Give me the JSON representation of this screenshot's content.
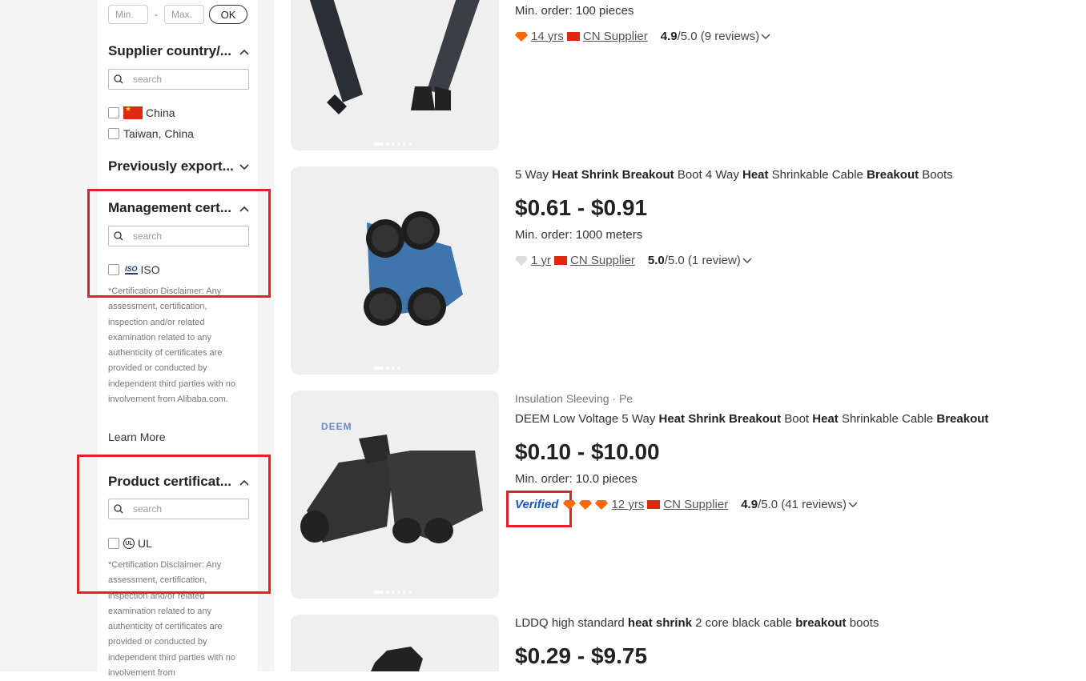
{
  "filters": {
    "price": {
      "min_placeholder": "Min.",
      "max_placeholder": "Max.",
      "dash": "-",
      "ok_label": "OK"
    },
    "supplier_country": {
      "title": "Supplier country/...",
      "search_placeholder": "search",
      "options": [
        "China",
        "Taiwan, China"
      ]
    },
    "previously_export": {
      "title": "Previously export..."
    },
    "management_cert": {
      "title": "Management cert...",
      "search_placeholder": "search",
      "option": "ISO",
      "option_logo": "ISO",
      "disclaimer": "*Certification Disclaimer: Any assessment, certification, inspection and/or related examination related to any authenticity of certificates are provided or conducted by independent third parties with no involvement from Alibaba.com.",
      "learn_more": "Learn More"
    },
    "product_cert": {
      "title": "Product certificat...",
      "search_placeholder": "search",
      "option": "UL",
      "option_logo": "UL",
      "disclaimer": "*Certification Disclaimer: Any assessment, certification, inspection and/or related examination related to any authenticity of certificates are provided or conducted by independent third parties with no involvement from"
    }
  },
  "products": [
    {
      "min_order": "Min. order: 100 pieces",
      "years": "14 yrs",
      "supplier": "CN Supplier",
      "rating": "4.9",
      "rating_suffix": "/5.0 (9 reviews)"
    },
    {
      "title_parts": [
        "5 Way ",
        "Heat Shrink Breakout",
        " Boot 4 Way ",
        "Heat",
        " Shrinkable Cable ",
        "Breakout",
        " Boots"
      ],
      "price": "$0.61 - $0.91",
      "min_order": "Min. order: 1000 meters",
      "years": "1 yr",
      "supplier": "CN Supplier",
      "rating": "5.0",
      "rating_suffix": "/5.0 (1 review)"
    },
    {
      "category": "Insulation Sleeving · Pe",
      "title_parts": [
        "DEEM Low Voltage 5 Way ",
        "Heat Shrink Breakout",
        " Boot ",
        "Heat",
        " Shrinkable Cable ",
        "Breakout"
      ],
      "price": "$0.10 - $10.00",
      "min_order": "Min. order: 10.0 pieces",
      "verified_label": "Verified",
      "years": "12 yrs",
      "supplier": "CN Supplier",
      "rating": "4.9",
      "rating_suffix": "/5.0 (41 reviews)",
      "image_brand": "DEEM"
    },
    {
      "title_parts": [
        "LDDQ high standard ",
        "heat shrink",
        " 2 core black cable ",
        "breakout",
        " boots"
      ],
      "price": "$0.29 - $9.75"
    }
  ],
  "colors": {
    "accent": "#e0232b",
    "diamond": "#ff6a00",
    "verified": "#1a56c8",
    "flag": "#de2910"
  }
}
